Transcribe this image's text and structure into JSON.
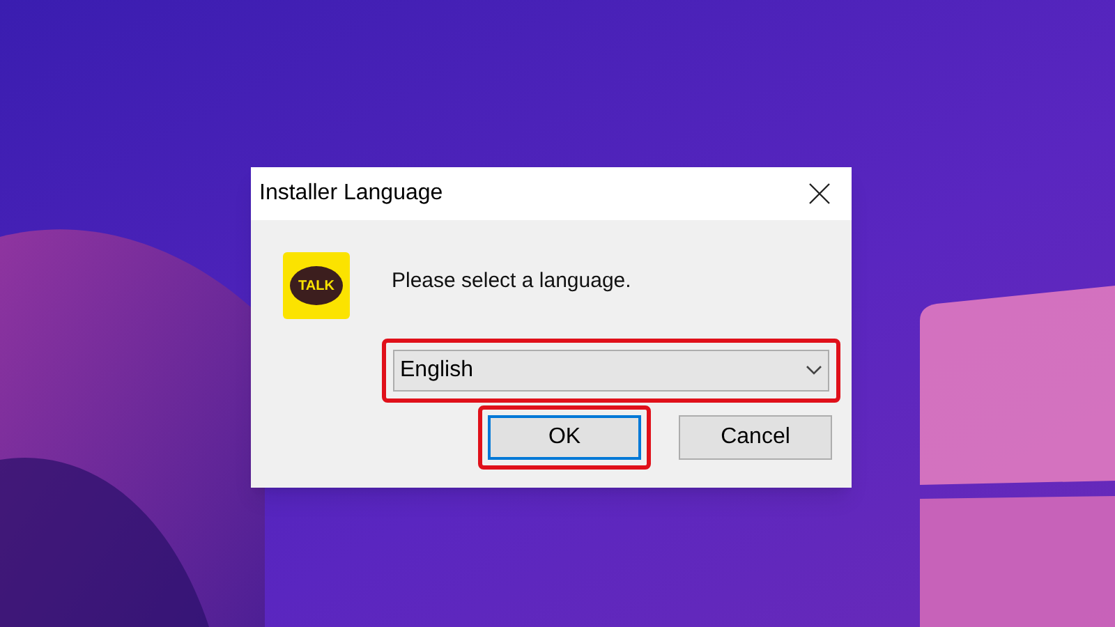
{
  "window": {
    "title": "Installer Language"
  },
  "logo": {
    "text": "TALK"
  },
  "prompt": "Please select a language.",
  "language_select": {
    "value": "English",
    "highlighted": true
  },
  "buttons": [
    {
      "label": "OK",
      "focused": true,
      "highlighted": true
    },
    {
      "label": "Cancel",
      "focused": false,
      "highlighted": false
    }
  ]
}
